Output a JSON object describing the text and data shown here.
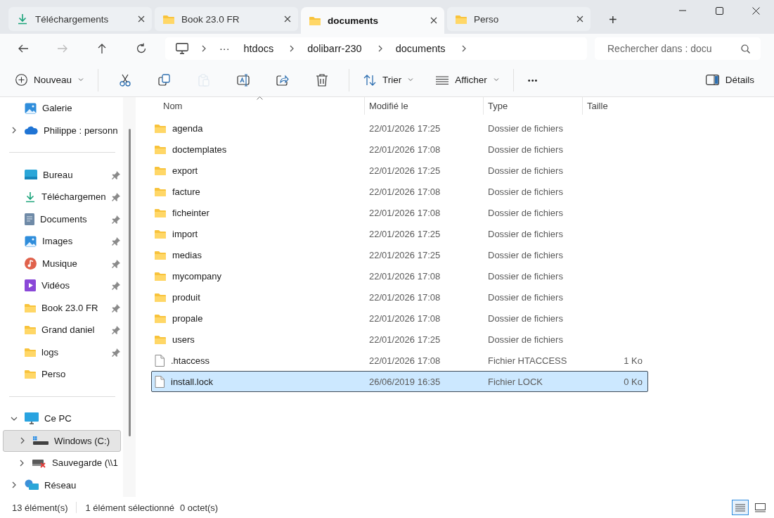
{
  "tabs": [
    {
      "label": "Téléchargements",
      "kind": "download",
      "selected": false
    },
    {
      "label": "Book 23.0 FR",
      "kind": "folder",
      "selected": false
    },
    {
      "label": "documents",
      "kind": "folder",
      "selected": true
    },
    {
      "label": "Perso",
      "kind": "folder",
      "selected": false
    }
  ],
  "new_tab": "+",
  "nav_buttons": [
    {
      "kind": "back",
      "disabled": false
    },
    {
      "kind": "forward",
      "disabled": true
    },
    {
      "kind": "up",
      "disabled": false
    },
    {
      "kind": "refresh",
      "disabled": false
    }
  ],
  "address": {
    "ellipsis": "···",
    "crumbs": [
      "htdocs",
      "dolibarr-230",
      "documents"
    ]
  },
  "search": {
    "placeholder": "Rechercher dans : docu"
  },
  "toolbar": {
    "new_button": "Nouveau",
    "actions": [
      {
        "kind": "cut",
        "disabled": false
      },
      {
        "kind": "copy",
        "disabled": false
      },
      {
        "kind": "paste",
        "disabled": true
      },
      {
        "kind": "rename",
        "disabled": false
      },
      {
        "kind": "share",
        "disabled": false
      },
      {
        "kind": "delete",
        "disabled": false
      }
    ],
    "sort_button": "Trier",
    "view_button": "Afficher",
    "more": "•••",
    "details_button": "Détails"
  },
  "sidebar": {
    "items": [
      {
        "kind": "gallery",
        "label": "Galerie",
        "pinned": false,
        "selected": false
      },
      {
        "kind": "cloud",
        "label": "Philippe : personn",
        "pinned": false,
        "selected": false,
        "expanded": false
      },
      {
        "kind": "divider"
      },
      {
        "kind": "desktop",
        "label": "Bureau",
        "pinned": true,
        "selected": false
      },
      {
        "kind": "download",
        "label": "Téléchargemen",
        "pinned": true,
        "selected": false
      },
      {
        "kind": "documents",
        "label": "Documents",
        "pinned": true,
        "selected": false
      },
      {
        "kind": "gallery",
        "label": "Images",
        "pinned": true,
        "selected": false
      },
      {
        "kind": "music",
        "label": "Musique",
        "pinned": true,
        "selected": false
      },
      {
        "kind": "videos",
        "label": "Vidéos",
        "pinned": true,
        "selected": false
      },
      {
        "kind": "folder",
        "label": "Book 23.0 FR",
        "pinned": true,
        "selected": false
      },
      {
        "kind": "folder",
        "label": "Grand daniel",
        "pinned": true,
        "selected": false
      },
      {
        "kind": "folder",
        "label": "logs",
        "pinned": true,
        "selected": false
      },
      {
        "kind": "folder",
        "label": "Perso",
        "pinned": false,
        "selected": false
      },
      {
        "kind": "divider"
      },
      {
        "kind": "pc",
        "label": "Ce PC",
        "pinned": false,
        "selected": false,
        "expanded": true,
        "children": [
          {
            "kind": "drive",
            "label": "Windows (C:)",
            "pinned": false,
            "selected": true,
            "expanded": false
          },
          {
            "kind": "network_drive",
            "label": "Sauvegarde (\\\\1",
            "pinned": false,
            "selected": false,
            "expanded": false
          }
        ]
      },
      {
        "kind": "network",
        "label": "Réseau",
        "pinned": false,
        "selected": false,
        "expanded": false
      }
    ]
  },
  "file_list": {
    "columns": [
      "Nom",
      "Modifié le",
      "Type",
      "Taille"
    ],
    "rows": [
      {
        "kind": "folder",
        "name": "agenda",
        "modified": "22/01/2026 17:25",
        "type": "Dossier de fichiers",
        "selected": false
      },
      {
        "kind": "folder",
        "name": "doctemplates",
        "modified": "22/01/2026 17:08",
        "type": "Dossier de fichiers",
        "selected": false
      },
      {
        "kind": "folder",
        "name": "export",
        "modified": "22/01/2026 17:25",
        "type": "Dossier de fichiers",
        "selected": false
      },
      {
        "kind": "folder",
        "name": "facture",
        "modified": "22/01/2026 17:08",
        "type": "Dossier de fichiers",
        "selected": false
      },
      {
        "kind": "folder",
        "name": "ficheinter",
        "modified": "22/01/2026 17:08",
        "type": "Dossier de fichiers",
        "selected": false
      },
      {
        "kind": "folder",
        "name": "import",
        "modified": "22/01/2026 17:25",
        "type": "Dossier de fichiers",
        "selected": false
      },
      {
        "kind": "folder",
        "name": "medias",
        "modified": "22/01/2026 17:25",
        "type": "Dossier de fichiers",
        "selected": false
      },
      {
        "kind": "folder",
        "name": "mycompany",
        "modified": "22/01/2026 17:08",
        "type": "Dossier de fichiers",
        "selected": false
      },
      {
        "kind": "folder",
        "name": "produit",
        "modified": "22/01/2026 17:08",
        "type": "Dossier de fichiers",
        "selected": false
      },
      {
        "kind": "folder",
        "name": "propale",
        "modified": "22/01/2026 17:08",
        "type": "Dossier de fichiers",
        "selected": false
      },
      {
        "kind": "folder",
        "name": "users",
        "modified": "22/01/2026 17:25",
        "type": "Dossier de fichiers",
        "selected": false
      },
      {
        "kind": "file",
        "name": ".htaccess",
        "modified": "22/01/2026 17:08",
        "type": "Fichier HTACCESS",
        "size": "1 Ko",
        "selected": false
      },
      {
        "kind": "file",
        "name": "install.lock",
        "modified": "26/06/2019 16:35",
        "type": "Fichier LOCK",
        "size": "0 Ko",
        "selected": true
      }
    ]
  },
  "status_bar": {
    "item_count": "13 élément(s)",
    "selection": "1 élément sélectionné",
    "selection_size": "0 octet(s)",
    "views": [
      {
        "kind": "details",
        "selected": true
      },
      {
        "kind": "tiles",
        "selected": false
      }
    ]
  }
}
